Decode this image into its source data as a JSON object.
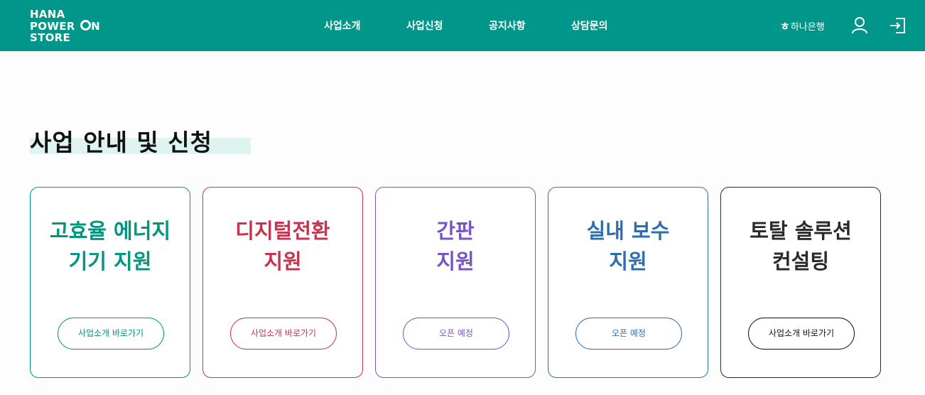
{
  "header": {
    "logo": {
      "line1": "HANA",
      "line2_a": "POWER ",
      "line2_b": "N",
      "line3": "STORE"
    },
    "nav": [
      "사업소개",
      "사업신청",
      "공지사항",
      "상담문의"
    ],
    "bank": {
      "mark": "ㅎ",
      "text": "하나은행"
    },
    "icons": {
      "user": "user-icon",
      "login": "login-icon"
    }
  },
  "section": {
    "title": "사업 안내 및 신청",
    "highlight_color": "#dff4f1"
  },
  "cards": [
    {
      "title": "고효율 에너지\n기기 지원",
      "button": "사업소개 바로가기",
      "color": "#00967f"
    },
    {
      "title": "디지털전환\n지원",
      "button": "사업소개 바로가기",
      "color": "#c8334f"
    },
    {
      "title": "간판\n지원",
      "button": "오픈 예정",
      "color": "#7a55c2"
    },
    {
      "title": "실내 보수\n지원",
      "button": "오픈 예정",
      "color": "#2c6fb1"
    },
    {
      "title": "토탈 솔루션\n컨설팅",
      "button": "사업소개 바로가기",
      "color": "#2a2a2a"
    }
  ],
  "colors": {
    "header_bg": "#00968a",
    "header_text": "#ffffff"
  }
}
